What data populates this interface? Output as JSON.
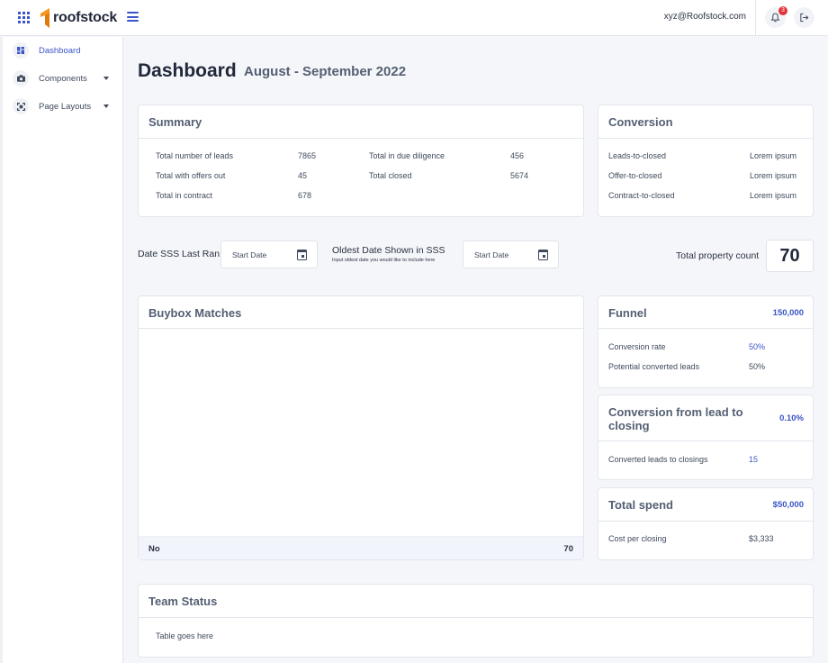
{
  "topbar": {
    "brand": "roofstock",
    "user_email": "xyz@Roofstock.com",
    "notification_count": "3",
    "icons": {
      "apps": "grid-icon",
      "menu": "hamburger-icon",
      "notifications": "bell-icon",
      "logout": "logout-icon"
    },
    "brand_color": "#f7941d",
    "accent_color": "#3b55c6"
  },
  "sidebar": {
    "items": [
      {
        "label": "Dashboard",
        "icon": "dashboard-icon",
        "active": true
      },
      {
        "label": "Components",
        "icon": "camera-icon",
        "active": false
      },
      {
        "label": "Page Layouts",
        "icon": "layout-icon",
        "active": false
      }
    ]
  },
  "header": {
    "title": "Dashboard",
    "period": "August - September 2022"
  },
  "summary": {
    "title": "Summary",
    "left": [
      {
        "label": "Total number of leads",
        "value": "7865"
      },
      {
        "label": "Total with offers out",
        "value": "45"
      },
      {
        "label": "Total in contract",
        "value": "678"
      }
    ],
    "right": [
      {
        "label": "Total in due diligence",
        "value": "456"
      },
      {
        "label": "Total closed",
        "value": "5674"
      }
    ]
  },
  "conversion": {
    "title": "Conversion",
    "rows": [
      {
        "label": "Leads-to-closed",
        "value": "Lorem ipsum"
      },
      {
        "label": "Offer-to-closed",
        "value": "Lorem ipsum"
      },
      {
        "label": "Contract-to-closed",
        "value": "Lorem ipsum"
      }
    ]
  },
  "filters": {
    "last_ran_label": "Date SSS Last Ran",
    "last_ran_placeholder": "Start Date",
    "oldest_label": "Oldest Date Shown in SSS",
    "oldest_hint": "Input oldest date you would like to include here",
    "oldest_placeholder": "Start Date",
    "total_count_label": "Total property count",
    "total_count_value": "70"
  },
  "buybox": {
    "title": "Buybox Matches",
    "footer_label": "No",
    "footer_value": "70"
  },
  "funnel": {
    "title": "Funnel",
    "value": "150,000",
    "rows": [
      {
        "label": "Conversion rate",
        "value": "50%"
      },
      {
        "label": "Potential converted leads",
        "value": "50%"
      }
    ]
  },
  "lead_to_closing": {
    "title_line1": "Conversion from lead to",
    "title_line2": "closing",
    "value": "0.10%",
    "rows": [
      {
        "label": "Converted leads to closings",
        "value": "15"
      }
    ]
  },
  "total_spend": {
    "title": "Total spend",
    "value": "$50,000",
    "rows": [
      {
        "label": "Cost per closing",
        "value": "$3,333"
      }
    ]
  },
  "team_status": {
    "title": "Team Status",
    "body": "Table goes here"
  }
}
